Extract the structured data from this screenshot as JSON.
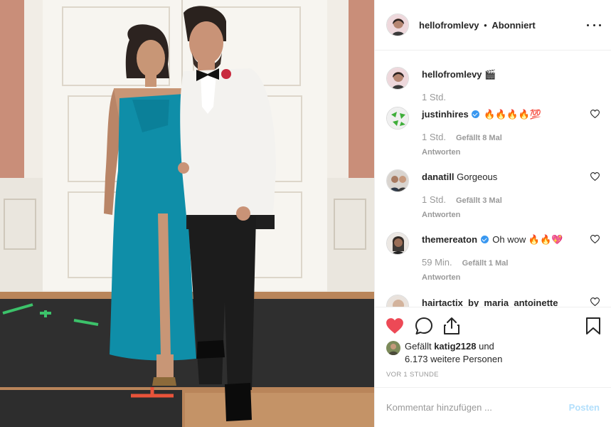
{
  "header": {
    "username": "hellofromlevy",
    "separator": "•",
    "follow_state": "Abonniert",
    "more_icon": "more-horizontal-icon"
  },
  "caption": {
    "username": "hellofromlevy",
    "text": "🎬",
    "time": "1 Std."
  },
  "comments": [
    {
      "username": "justinhires",
      "verified": true,
      "text": "🔥🔥🔥🔥💯",
      "time": "1 Std.",
      "likes": "Gefällt 8 Mal",
      "reply": "Antworten"
    },
    {
      "username": "danatill",
      "verified": false,
      "text": "Gorgeous",
      "time": "1 Std.",
      "likes": "Gefällt 3 Mal",
      "reply": "Antworten"
    },
    {
      "username": "themereaton",
      "verified": true,
      "text": "Oh wow 🔥🔥💖",
      "time": "59 Min.",
      "likes": "Gefällt 1 Mal",
      "reply": "Antworten"
    },
    {
      "username": "hairtactix_by_maria_antoinette",
      "verified": false,
      "text": "",
      "time": "",
      "likes": "",
      "reply": ""
    }
  ],
  "likes": {
    "prefix": "Gefällt",
    "user": "katig2128",
    "suffix": "und",
    "others": "6.173 weitere Personen"
  },
  "time_ago": "VOR 1 STUNDE",
  "add_comment": {
    "placeholder": "Kommentar hinzufügen ...",
    "post_label": "Posten"
  },
  "colors": {
    "heart": "#ed4956",
    "post_disabled": "#b2dffc",
    "verified": "#3897f0"
  },
  "icons": {
    "like": "heart-filled-icon",
    "comment": "comment-bubble-icon",
    "share": "share-icon",
    "save": "bookmark-icon"
  }
}
